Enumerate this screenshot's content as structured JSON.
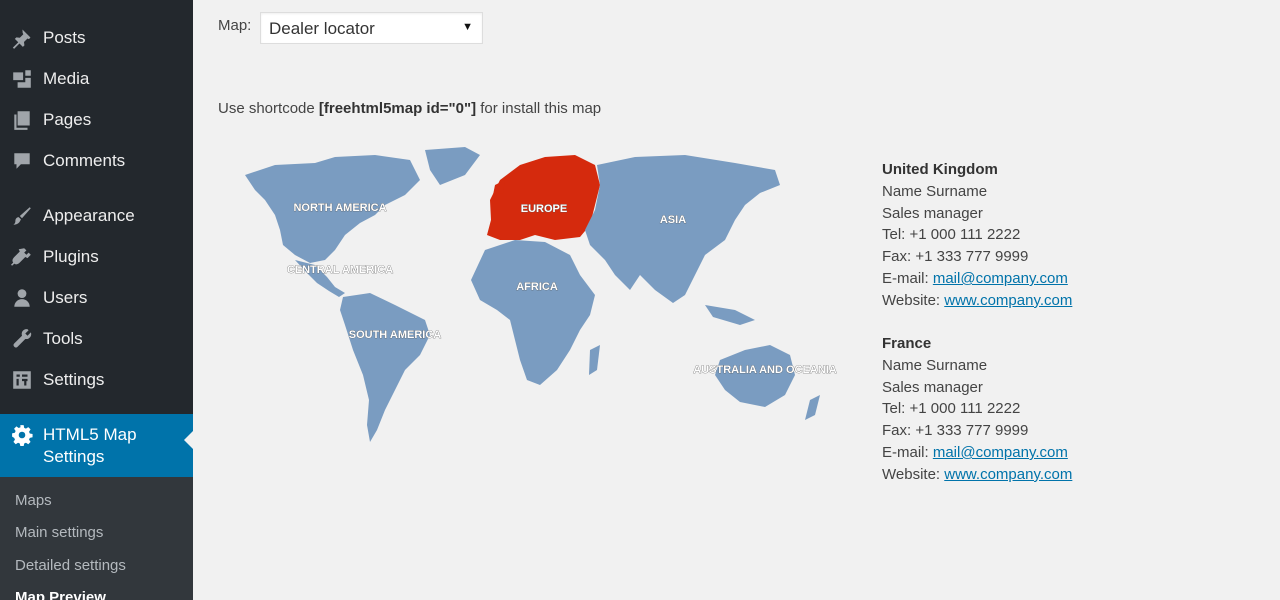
{
  "sidebar": {
    "items": [
      {
        "label": "Posts",
        "icon": "pin-icon"
      },
      {
        "label": "Media",
        "icon": "media-icon"
      },
      {
        "label": "Pages",
        "icon": "pages-icon"
      },
      {
        "label": "Comments",
        "icon": "comment-icon"
      },
      {
        "label": "Appearance",
        "icon": "brush-icon"
      },
      {
        "label": "Plugins",
        "icon": "plug-icon"
      },
      {
        "label": "Users",
        "icon": "user-icon"
      },
      {
        "label": "Tools",
        "icon": "wrench-icon"
      },
      {
        "label": "Settings",
        "icon": "settings-icon"
      }
    ],
    "active": {
      "label_line1": "HTML5 Map",
      "label_line2": "Settings",
      "icon": "gear-icon"
    },
    "submenu": [
      "Maps",
      "Main settings",
      "Detailed settings",
      "Map Preview"
    ],
    "colors": {
      "bg": "#23282d",
      "active": "#0073aa",
      "submenu_bg": "#32373c"
    }
  },
  "main": {
    "map_label": "Map:",
    "map_selected": "Dealer locator",
    "shortcode_prefix": "Use shortcode ",
    "shortcode": "[freehtml5map id=\"0\"]",
    "shortcode_suffix": " for install this map"
  },
  "map": {
    "regions": [
      {
        "name": "NORTH AMERICA",
        "color": "#7a9cc1"
      },
      {
        "name": "CENTRAL AMERICA",
        "color": "#7a9cc1"
      },
      {
        "name": "SOUTH AMERICA",
        "color": "#7a9cc1"
      },
      {
        "name": "EUROPE",
        "color": "#d52a0d"
      },
      {
        "name": "AFRICA",
        "color": "#7a9cc1"
      },
      {
        "name": "ASIA",
        "color": "#7a9cc1"
      },
      {
        "name": "AUSTRALIA AND OCEANIA",
        "color": "#7a9cc1"
      }
    ]
  },
  "contacts": [
    {
      "country": "United Kingdom",
      "name": "Name Surname",
      "title": "Sales manager",
      "tel": "Tel: +1 000 111 2222",
      "fax": "Fax: +1 333 777 9999",
      "email_label": "E-mail: ",
      "email": "mail@company.com",
      "website_label": "Website: ",
      "website": "www.company.com"
    },
    {
      "country": "France",
      "name": "Name Surname",
      "title": "Sales manager",
      "tel": "Tel: +1 000 111 2222",
      "fax": "Fax: +1 333 777 9999",
      "email_label": "E-mail: ",
      "email": "mail@company.com",
      "website_label": "Website: ",
      "website": "www.company.com"
    }
  ]
}
